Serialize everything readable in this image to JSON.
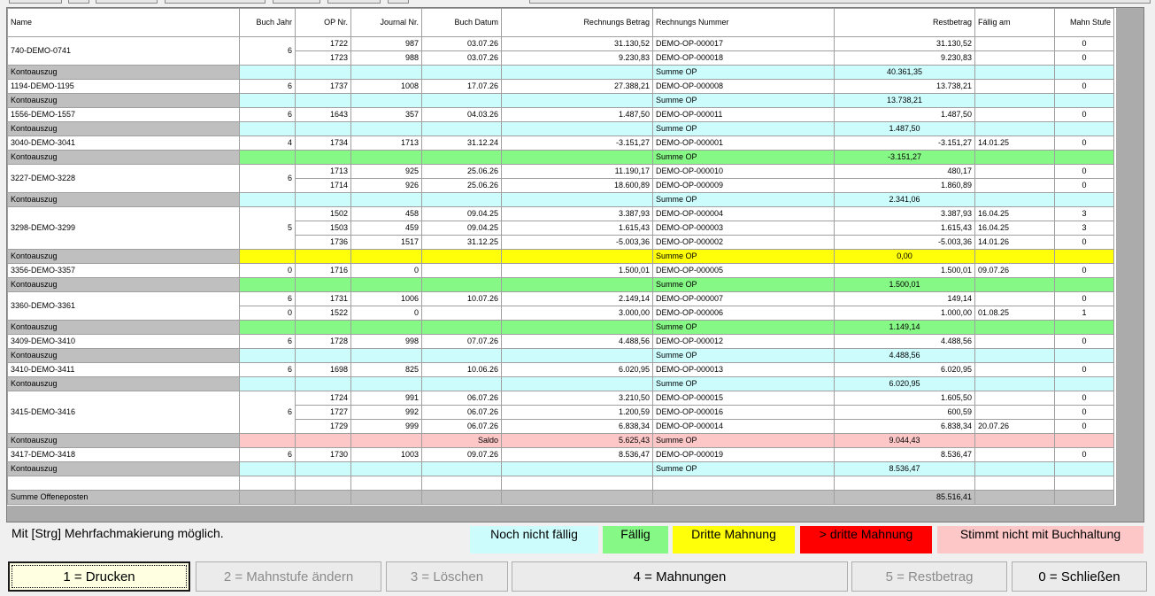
{
  "columns": [
    "Name",
    "Buch Jahr",
    "OP Nr.",
    "Journal Nr.",
    "Buch Datum",
    "Rechnungs Betrag",
    "Rechnungs Nummer",
    "Restbetrag",
    "Fällig am",
    "Mahn Stufe"
  ],
  "colors": {
    "noch_nicht_faellig": "#cdfcfd",
    "faellig": "#86f886",
    "dritte_mahnung": "#ffff0a",
    "ueber_dritte_mahnung": "#ff0000",
    "stimmt_nicht": "#fdc7c7",
    "kontoauszug_label": "#bfbfbf"
  },
  "groups": [
    {
      "name": "740-DEMO-0741",
      "jahr": "6",
      "status": "cyan",
      "rows": [
        {
          "op": "1722",
          "journal": "987",
          "datum": "03.07.26",
          "betrag": "31.130,52",
          "nummer": "DEMO-OP-000017",
          "rest": "31.130,52",
          "faellig": "",
          "mahn": "0"
        },
        {
          "op": "1723",
          "journal": "988",
          "datum": "03.07.26",
          "betrag": "9.230,83",
          "nummer": "DEMO-OP-000018",
          "rest": "9.230,83",
          "faellig": "",
          "mahn": "0"
        }
      ],
      "summary": {
        "label": "Kontoauszug",
        "saldo_label": "",
        "saldo": "",
        "nummer": "Summe OP",
        "rest": "40.361,35"
      }
    },
    {
      "name": "1194-DEMO-1195",
      "jahr": "6",
      "status": "cyan",
      "rows": [
        {
          "op": "1737",
          "journal": "1008",
          "datum": "17.07.26",
          "betrag": "27.388,21",
          "nummer": "DEMO-OP-000008",
          "rest": "13.738,21",
          "faellig": "",
          "mahn": "0"
        }
      ],
      "summary": {
        "label": "Kontoauszug",
        "saldo_label": "",
        "saldo": "",
        "nummer": "Summe OP",
        "rest": "13.738,21"
      }
    },
    {
      "name": "1556-DEMO-1557",
      "jahr": "6",
      "status": "cyan",
      "rows": [
        {
          "op": "1643",
          "journal": "357",
          "datum": "04.03.26",
          "betrag": "1.487,50",
          "nummer": "DEMO-OP-000011",
          "rest": "1.487,50",
          "faellig": "",
          "mahn": "0"
        }
      ],
      "summary": {
        "label": "Kontoauszug",
        "saldo_label": "",
        "saldo": "",
        "nummer": "Summe OP",
        "rest": "1.487,50"
      }
    },
    {
      "name": "3040-DEMO-3041",
      "jahr": "4",
      "status": "green",
      "rows": [
        {
          "op": "1734",
          "journal": "1713",
          "datum": "31.12.24",
          "betrag": "-3.151,27",
          "nummer": "DEMO-OP-000001",
          "rest": "-3.151,27",
          "faellig": "14.01.25",
          "mahn": "0"
        }
      ],
      "summary": {
        "label": "Kontoauszug",
        "saldo_label": "",
        "saldo": "",
        "nummer": "Summe OP",
        "rest": "-3.151,27"
      }
    },
    {
      "name": "3227-DEMO-3228",
      "jahr": "6",
      "status": "cyan",
      "rows": [
        {
          "op": "1713",
          "journal": "925",
          "datum": "25.06.26",
          "betrag": "11.190,17",
          "nummer": "DEMO-OP-000010",
          "rest": "480,17",
          "faellig": "",
          "mahn": "0"
        },
        {
          "op": "1714",
          "journal": "926",
          "datum": "25.06.26",
          "betrag": "18.600,89",
          "nummer": "DEMO-OP-000009",
          "rest": "1.860,89",
          "faellig": "",
          "mahn": "0"
        }
      ],
      "summary": {
        "label": "Kontoauszug",
        "saldo_label": "",
        "saldo": "",
        "nummer": "Summe OP",
        "rest": "2.341,06"
      }
    },
    {
      "name": "3298-DEMO-3299",
      "jahr": "5",
      "status": "yellow",
      "rows": [
        {
          "op": "1502",
          "journal": "458",
          "datum": "09.04.25",
          "betrag": "3.387,93",
          "nummer": "DEMO-OP-000004",
          "rest": "3.387,93",
          "faellig": "16.04.25",
          "mahn": "3"
        },
        {
          "op": "1503",
          "journal": "459",
          "datum": "09.04.25",
          "betrag": "1.615,43",
          "nummer": "DEMO-OP-000003",
          "rest": "1.615,43",
          "faellig": "16.04.25",
          "mahn": "3"
        },
        {
          "op": "1736",
          "journal": "1517",
          "datum": "31.12.25",
          "betrag": "-5.003,36",
          "nummer": "DEMO-OP-000002",
          "rest": "-5.003,36",
          "faellig": "14.01.26",
          "mahn": "0"
        }
      ],
      "summary": {
        "label": "Kontoauszug",
        "saldo_label": "",
        "saldo": "",
        "nummer": "Summe OP",
        "rest": "0,00"
      }
    },
    {
      "name": "3356-DEMO-3357",
      "jahr": "0",
      "status": "green",
      "rows": [
        {
          "op": "1716",
          "journal": "0",
          "datum": "",
          "betrag": "1.500,01",
          "nummer": "DEMO-OP-000005",
          "rest": "1.500,01",
          "faellig": "09.07.26",
          "mahn": "0"
        }
      ],
      "summary": {
        "label": "Kontoauszug",
        "saldo_label": "",
        "saldo": "",
        "nummer": "Summe OP",
        "rest": "1.500,01"
      }
    },
    {
      "name": "3360-DEMO-3361",
      "jahr": "",
      "status": "green",
      "rows": [
        {
          "jahr": "6",
          "op": "1731",
          "journal": "1006",
          "datum": "10.07.26",
          "betrag": "2.149,14",
          "nummer": "DEMO-OP-000007",
          "rest": "149,14",
          "faellig": "",
          "mahn": "0"
        },
        {
          "jahr": "0",
          "op": "1522",
          "journal": "0",
          "datum": "",
          "betrag": "3.000,00",
          "nummer": "DEMO-OP-000006",
          "rest": "1.000,00",
          "faellig": "01.08.25",
          "mahn": "1"
        }
      ],
      "summary": {
        "label": "Kontoauszug",
        "saldo_label": "",
        "saldo": "",
        "nummer": "Summe OP",
        "rest": "1.149,14"
      }
    },
    {
      "name": "3409-DEMO-3410",
      "jahr": "6",
      "status": "cyan",
      "rows": [
        {
          "op": "1728",
          "journal": "998",
          "datum": "07.07.26",
          "betrag": "4.488,56",
          "nummer": "DEMO-OP-000012",
          "rest": "4.488,56",
          "faellig": "",
          "mahn": "0"
        }
      ],
      "summary": {
        "label": "Kontoauszug",
        "saldo_label": "",
        "saldo": "",
        "nummer": "Summe OP",
        "rest": "4.488,56"
      }
    },
    {
      "name": "3410-DEMO-3411",
      "jahr": "6",
      "status": "cyan",
      "rows": [
        {
          "op": "1698",
          "journal": "825",
          "datum": "10.06.26",
          "betrag": "6.020,95",
          "nummer": "DEMO-OP-000013",
          "rest": "6.020,95",
          "faellig": "",
          "mahn": "0"
        }
      ],
      "summary": {
        "label": "Kontoauszug",
        "saldo_label": "",
        "saldo": "",
        "nummer": "Summe OP",
        "rest": "6.020,95"
      }
    },
    {
      "name": "3415-DEMO-3416",
      "jahr": "6",
      "status": "pink",
      "rows": [
        {
          "op": "1724",
          "journal": "991",
          "datum": "06.07.26",
          "betrag": "3.210,50",
          "nummer": "DEMO-OP-000015",
          "rest": "1.605,50",
          "faellig": "",
          "mahn": "0"
        },
        {
          "op": "1727",
          "journal": "992",
          "datum": "06.07.26",
          "betrag": "1.200,59",
          "nummer": "DEMO-OP-000016",
          "rest": "600,59",
          "faellig": "",
          "mahn": "0"
        },
        {
          "op": "1729",
          "journal": "999",
          "datum": "06.07.26",
          "betrag": "6.838,34",
          "nummer": "DEMO-OP-000014",
          "rest": "6.838,34",
          "faellig": "20.07.26",
          "mahn": "0"
        }
      ],
      "summary": {
        "label": "Kontoauszug",
        "saldo_label": "Saldo",
        "saldo": "5.625,43",
        "nummer": "Summe OP",
        "rest": "9.044,43"
      }
    },
    {
      "name": "3417-DEMO-3418",
      "jahr": "6",
      "status": "cyan",
      "rows": [
        {
          "op": "1730",
          "journal": "1003",
          "datum": "09.07.26",
          "betrag": "8.536,47",
          "nummer": "DEMO-OP-000019",
          "rest": "8.536,47",
          "faellig": "",
          "mahn": "0"
        }
      ],
      "summary": {
        "label": "Kontoauszug",
        "saldo_label": "",
        "saldo": "",
        "nummer": "Summe OP",
        "rest": "8.536,47"
      }
    }
  ],
  "total": {
    "label": "Summe Offeneposten",
    "value": "85.516,41"
  },
  "hint": "Mit [Strg] Mehrfachmakierung möglich.",
  "legend": {
    "noch_nicht_faellig": "Noch nicht fällig",
    "faellig": "Fällig",
    "dritte_mahnung": "Dritte Mahnung",
    "ueber_dritte": "> dritte Mahnung",
    "stimmt_nicht": "Stimmt nicht mit Buchhaltung"
  },
  "buttons": {
    "drucken": "1 = Drucken",
    "mahnstufe": "2 = Mahnstufe ändern",
    "loeschen": "3 = Löschen",
    "mahnungen": "4 = Mahnungen",
    "restbetrag": "5 = Restbetrag",
    "schliessen": "0 = Schließen"
  }
}
